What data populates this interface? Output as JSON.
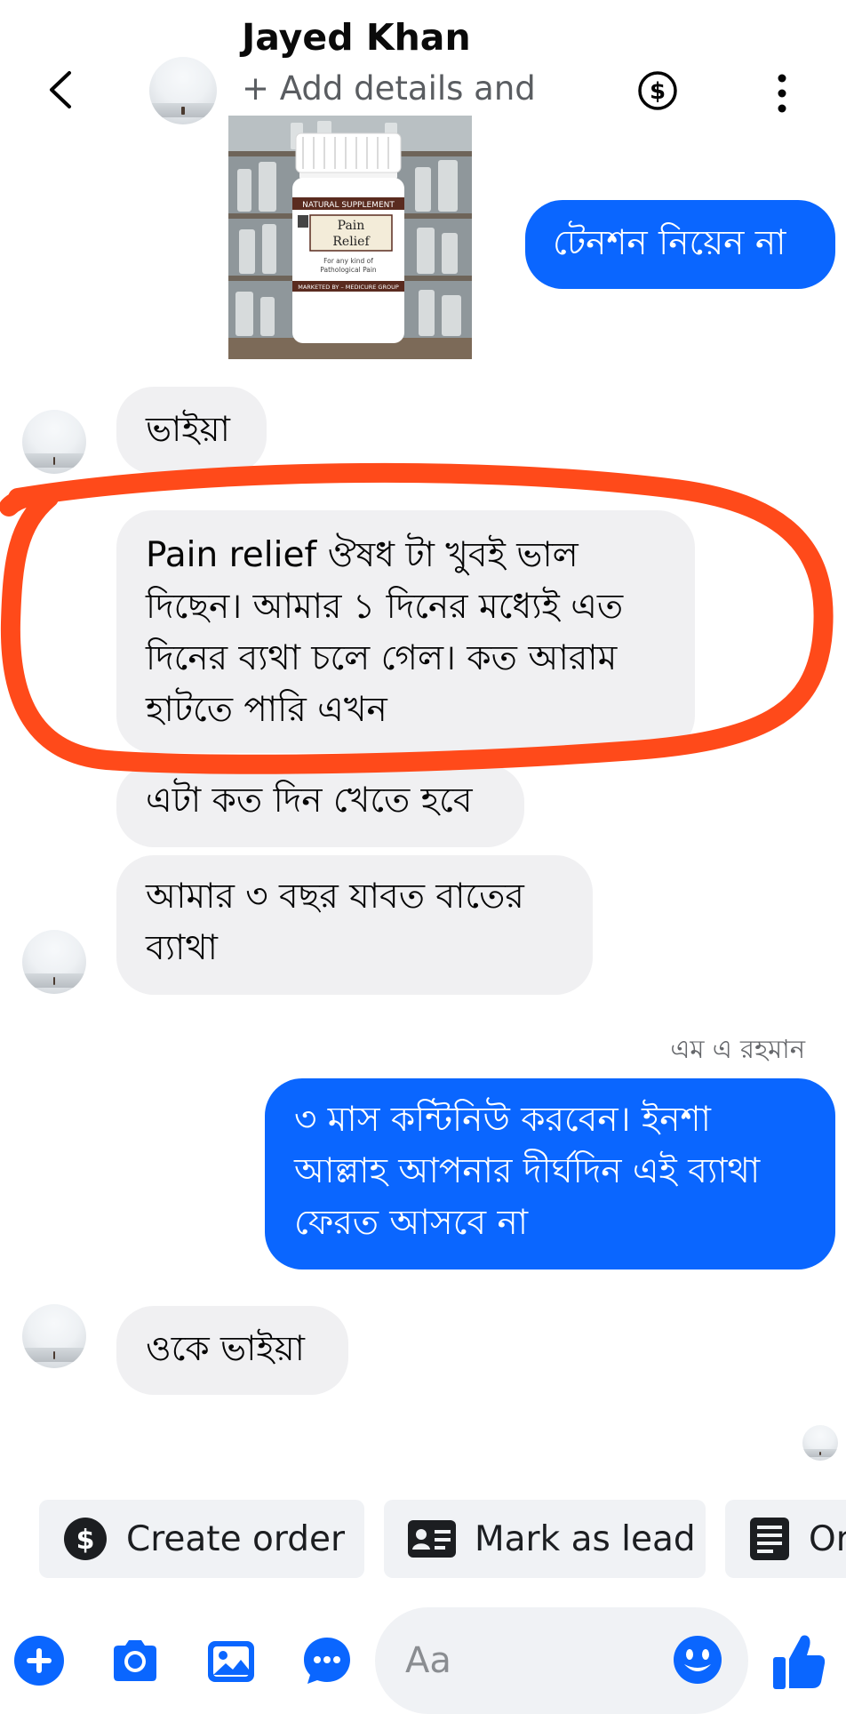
{
  "header": {
    "title": "Jayed Khan",
    "subtitle": "+ Add details and",
    "icons": [
      "back-icon",
      "avatar",
      "dollar-circle-icon",
      "more-vertical-icon"
    ]
  },
  "product_image": {
    "label_top": "NATURAL SUPPLEMENT",
    "label_name_line1": "Pain",
    "label_name_line2": "Relief",
    "label_desc_line1": "For any kind of",
    "label_desc_line2": "Pathological Pain",
    "label_bottom": "MARKETED BY – MEDICURE GROUP"
  },
  "messages": [
    {
      "side": "out",
      "text": "টেনশন নিয়েন না"
    },
    {
      "side": "in",
      "text": "ভাইয়া"
    },
    {
      "side": "in",
      "text": "Pain relief ঔষধ টা খুবই ভাল দিছেন। আমার ১ দিনের মধ্যেই এত দিনের ব্যথা চলে গেল। কত আরাম হাটতে পারি এখন"
    },
    {
      "side": "in",
      "text": "এটা কত দিন খেতে হবে"
    },
    {
      "side": "in",
      "text": "আমার ৩ বছর যাবত বাতের ব্যাথা"
    },
    {
      "side": "out",
      "sender": "এম এ রহমান",
      "text": "৩ মাস কন্টিনিউ করবেন। ইনশা আল্লাহ আপনার দীর্ঘদিন এই ব্যাথা ফেরত আসবে না"
    },
    {
      "side": "in",
      "text": "ওকে ভাইয়া"
    }
  ],
  "actions": {
    "create_order": "Create order",
    "mark_as_lead": "Mark as lead",
    "third_partial": "Or"
  },
  "composer": {
    "placeholder": "Aa"
  },
  "colors": {
    "accent": "#0a66ff",
    "incoming_bubble": "#f0f0f2",
    "annotation": "#ff4a1a"
  }
}
